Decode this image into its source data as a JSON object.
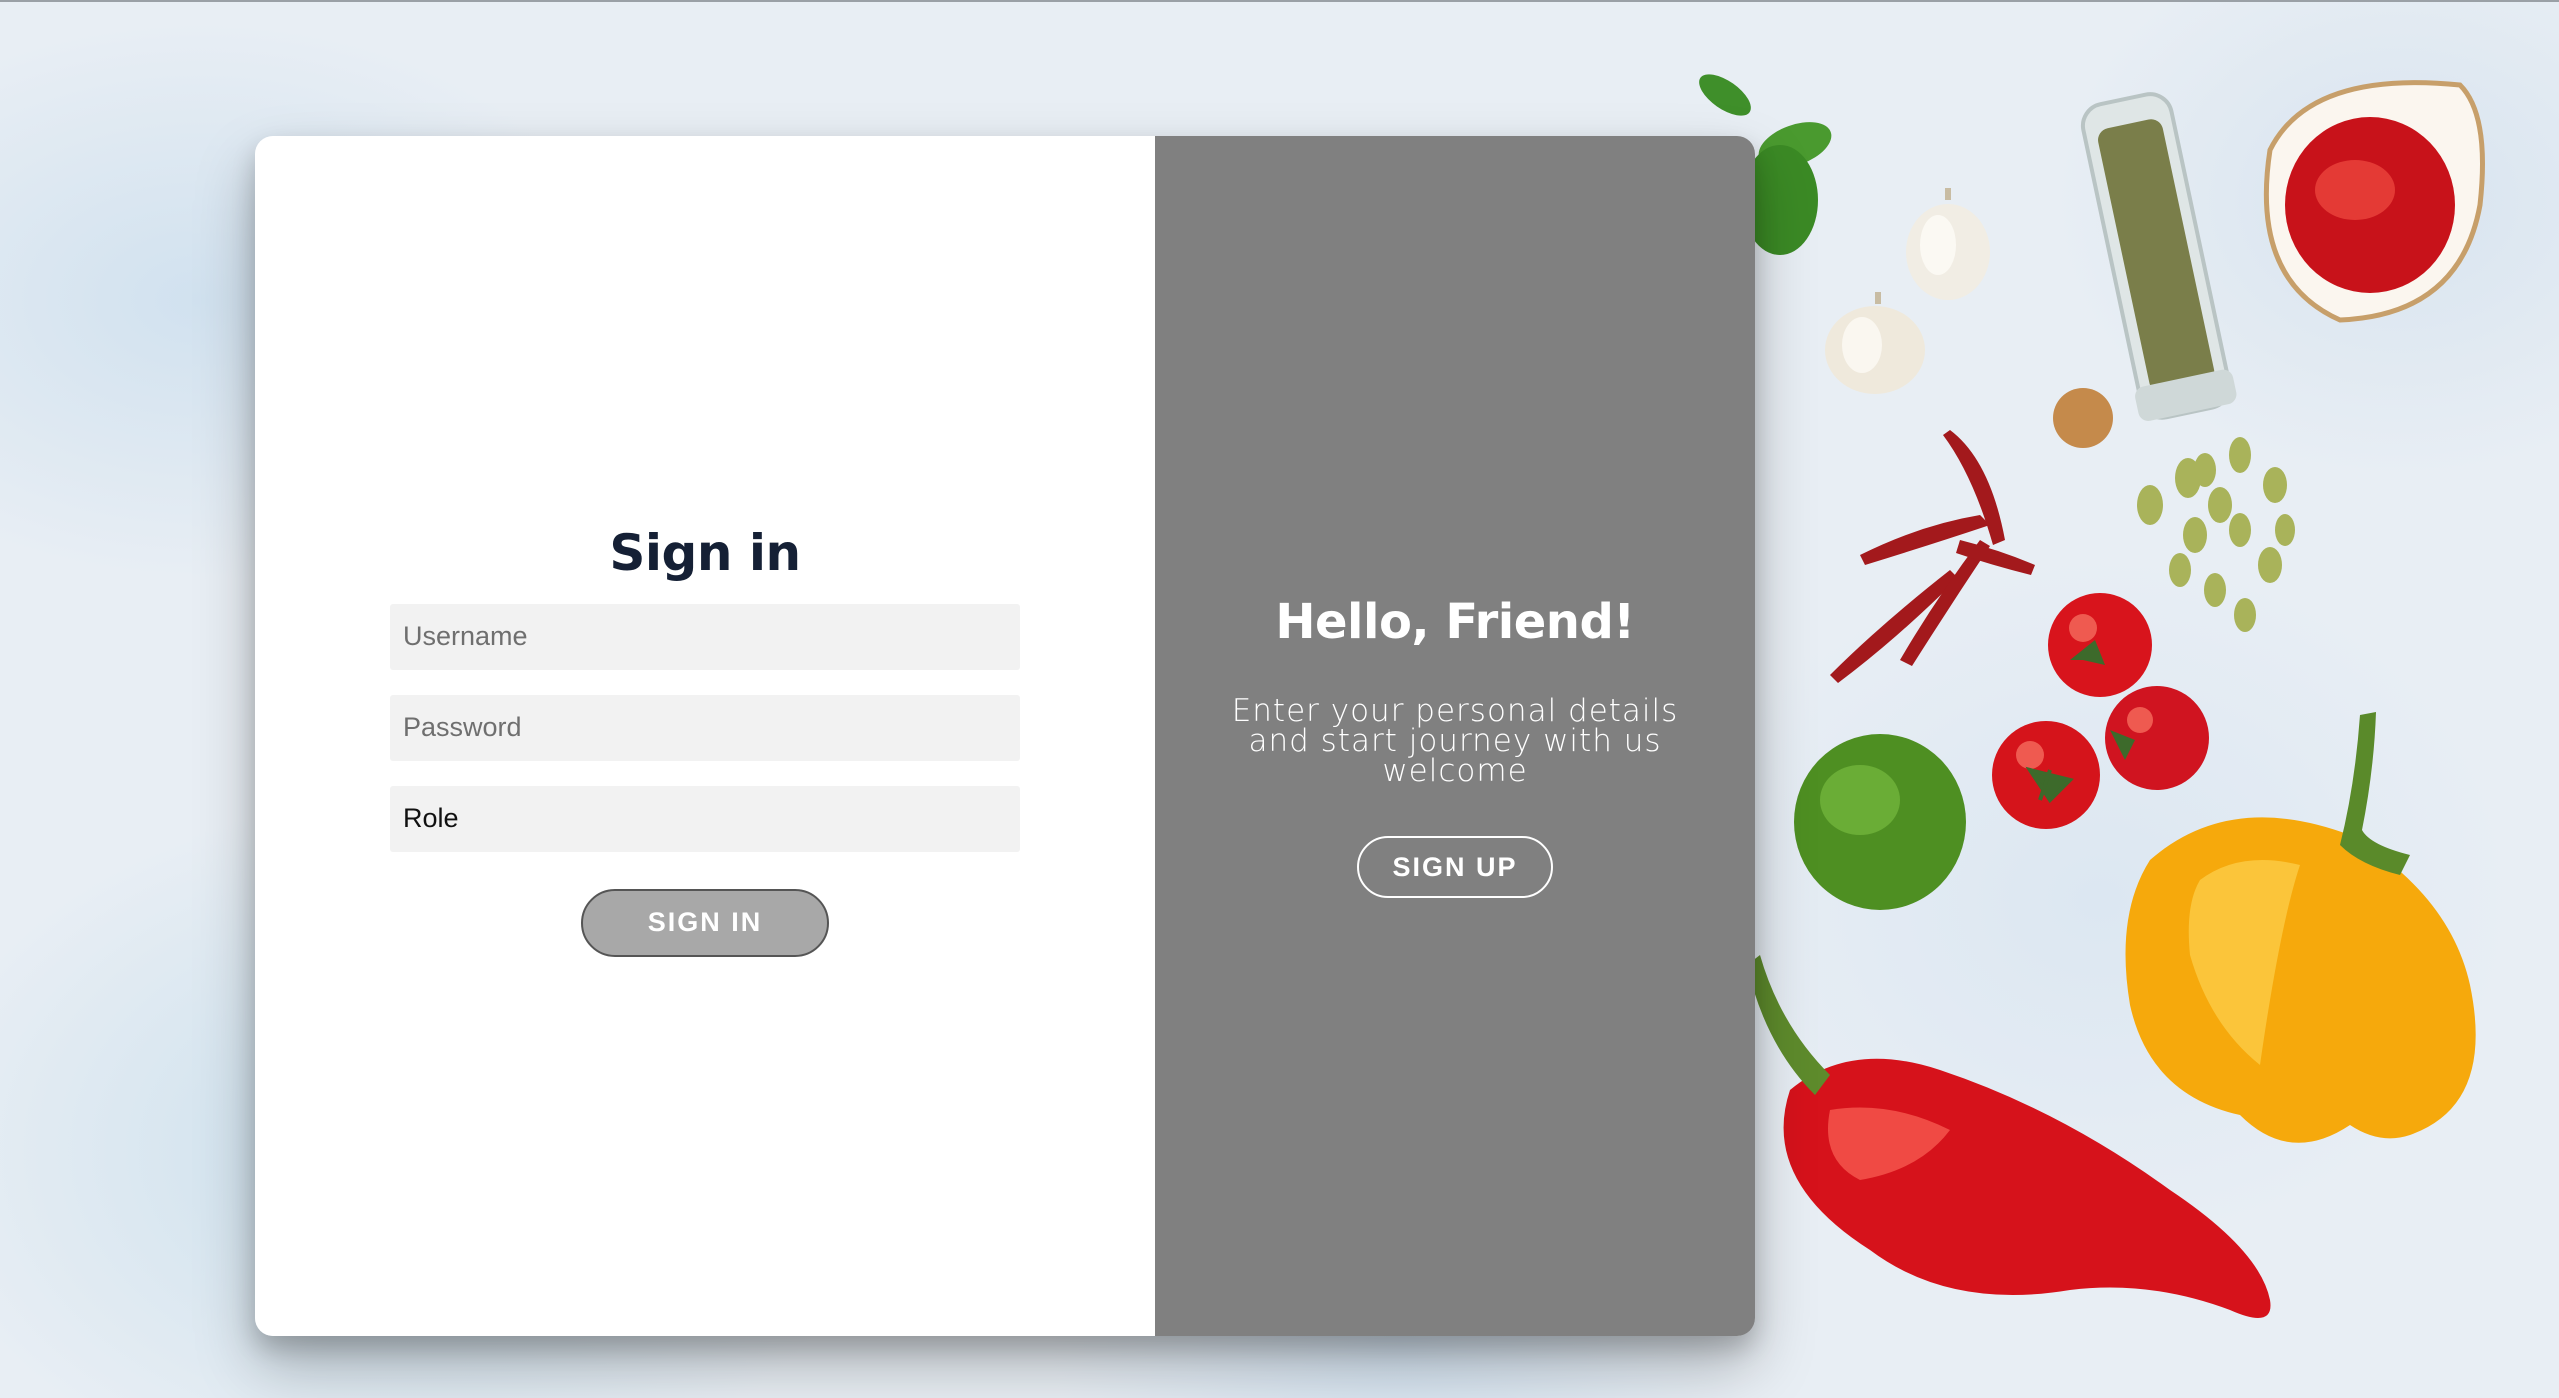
{
  "signin": {
    "title": "Sign in",
    "username_placeholder": "Username",
    "password_placeholder": "Password",
    "role_value": "Role",
    "button_label": "SIGN IN"
  },
  "welcome_panel": {
    "title": "Hello, Friend!",
    "description_lines": [
      "Enter your personal details",
      "and start journey with us",
      "welcome"
    ],
    "button_label": "SIGN UP"
  },
  "background": {
    "image_subject": "vegetables-and-spices-on-light-blue-surface"
  },
  "colors": {
    "card_left": "#ffffff",
    "card_right": "#808080",
    "title_text": "#152035",
    "input_bg": "#f2f2f2",
    "signin_button": "#a8a8a8"
  }
}
